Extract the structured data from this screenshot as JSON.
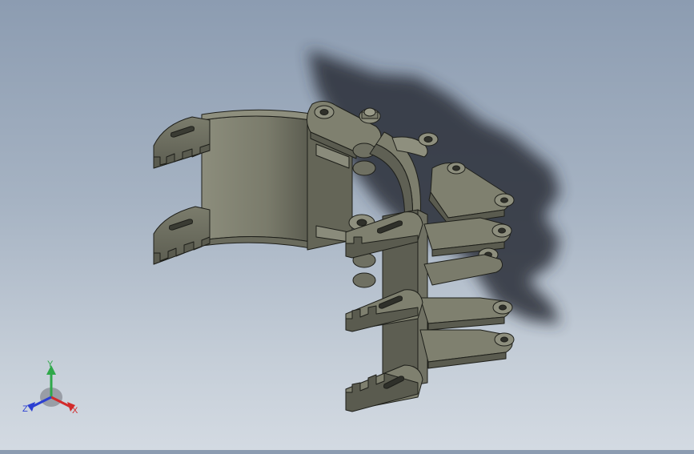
{
  "viewport": {
    "background_top": "#8c9cb1",
    "background_bottom": "#d3dae2",
    "model": {
      "part_color": "#6f7062",
      "part_light": "#8a8b7b",
      "part_dark": "#4e4f44",
      "edge_color": "#1e1f1a",
      "shadow_color": "#2a2f37"
    }
  },
  "triad": {
    "x_label": "X",
    "y_label": "Y",
    "z_label": "Z",
    "x_color": "#d22b2b",
    "y_color": "#2fa84a",
    "z_color": "#2b3fd2"
  }
}
